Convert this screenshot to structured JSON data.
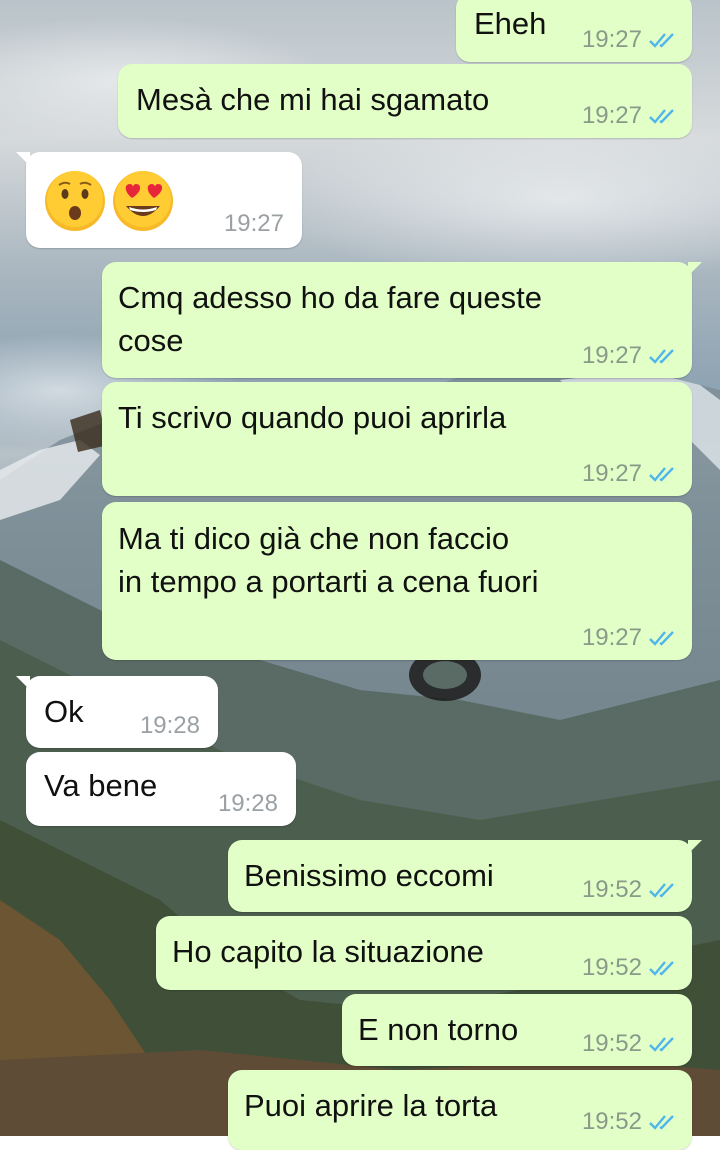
{
  "conversation": {
    "messages": [
      {
        "dir": "out",
        "text": "Eheh",
        "time": "19:27",
        "status": "read"
      },
      {
        "dir": "out",
        "text": "Mesà che mi hai sgamato",
        "time": "19:27",
        "status": "read"
      },
      {
        "dir": "in",
        "emoji": [
          "hushed-face",
          "smiling-face-with-heart-eyes"
        ],
        "time": "19:27"
      },
      {
        "dir": "out",
        "text_lines": [
          "Cmq adesso ho da fare queste",
          "cose"
        ],
        "time": "19:27",
        "status": "read"
      },
      {
        "dir": "out",
        "text": "Ti scrivo quando puoi aprirla",
        "time": "19:27",
        "status": "read"
      },
      {
        "dir": "out",
        "text_lines": [
          "Ma ti dico già che non faccio",
          "in tempo a portarti a cena fuori"
        ],
        "time": "19:27",
        "status": "read"
      },
      {
        "dir": "in",
        "text": "Ok",
        "time": "19:28"
      },
      {
        "dir": "in",
        "text": "Va bene",
        "time": "19:28"
      },
      {
        "dir": "out",
        "text": "Benissimo eccomi",
        "time": "19:52",
        "status": "read"
      },
      {
        "dir": "out",
        "text": "Ho capito la situazione",
        "time": "19:52",
        "status": "read"
      },
      {
        "dir": "out",
        "text": "E non torno",
        "time": "19:52",
        "status": "read"
      },
      {
        "dir": "out",
        "text": "Puoi aprire la torta",
        "time": "19:52",
        "status": "read"
      }
    ]
  },
  "colors": {
    "outgoing_bubble": "#e2ffc7",
    "incoming_bubble": "#ffffff",
    "read_ticks": "#4fb6ec"
  },
  "icons": {
    "read_status": "double-check-icon"
  }
}
